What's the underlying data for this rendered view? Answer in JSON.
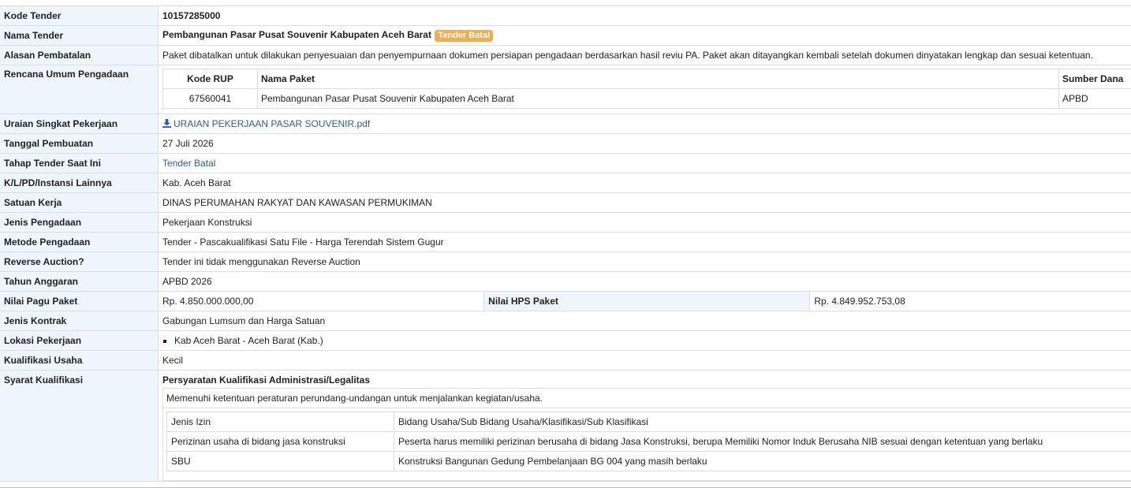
{
  "rows": {
    "kode_tender": {
      "label": "Kode Tender",
      "value": "10157285000"
    },
    "nama_tender": {
      "label": "Nama Tender",
      "value": "Pembangunan Pasar Pusat Souvenir Kabupaten Aceh Barat",
      "badge": "Tender Batal"
    },
    "alasan": {
      "label": "Alasan Pembatalan",
      "value": "Paket dibatalkan untuk dilakukan penyesuaian dan penyempurnaan dokumen persiapan pengadaan berdasarkan hasil reviu PA. Paket akan ditayangkan kembali setelah dokumen dinyatakan lengkap dan sesuai ketentuan."
    },
    "rup": {
      "label": "Rencana Umum Pengadaan",
      "headers": {
        "kode": "Kode RUP",
        "nama": "Nama Paket",
        "sumber": "Sumber Dana"
      },
      "rows": [
        {
          "kode": "67560041",
          "nama": "Pembangunan Pasar Pusat Souvenir Kabupaten Aceh Barat",
          "sumber": "APBD"
        }
      ]
    },
    "uraian": {
      "label": "Uraian Singkat Pekerjaan",
      "link": "URAIAN PEKERJAAN PASAR SOUVENIR.pdf",
      "icon": "download-icon"
    },
    "tanggal": {
      "label": "Tanggal Pembuatan",
      "value": "27 Juli 2026"
    },
    "tahap": {
      "label": "Tahap Tender Saat Ini",
      "link": "Tender Batal"
    },
    "klpd": {
      "label": "K/L/PD/Instansi Lainnya",
      "value": "Kab. Aceh Barat"
    },
    "satker": {
      "label": "Satuan Kerja",
      "value": "DINAS PERUMAHAN RAKYAT DAN KAWASAN PERMUKIMAN"
    },
    "jenis": {
      "label": "Jenis Pengadaan",
      "value": "Pekerjaan Konstruksi"
    },
    "metode": {
      "label": "Metode Pengadaan",
      "value": "Tender - Pascakualifikasi Satu File - Harga Terendah Sistem Gugur"
    },
    "reverse": {
      "label": "Reverse Auction?",
      "value": "Tender ini tidak menggunakan Reverse Auction"
    },
    "tahun": {
      "label": "Tahun Anggaran",
      "value": "APBD 2026"
    },
    "pagu": {
      "label": "Nilai Pagu Paket",
      "value": "Rp. 4.850.000.000,00",
      "hps_label": "Nilai HPS Paket",
      "hps_value": "Rp. 4.849.952.753,08"
    },
    "kontrak": {
      "label": "Jenis Kontrak",
      "value": "Gabungan Lumsum dan Harga Satuan"
    },
    "lokasi": {
      "label": "Lokasi Pekerjaan",
      "items": [
        "Kab Aceh Barat - Aceh Barat (Kab.)"
      ]
    },
    "kualifikasi": {
      "label": "Kualifikasi Usaha",
      "value": "Kecil"
    },
    "syarat": {
      "label": "Syarat Kualifikasi",
      "title": "Persyaratan Kualifikasi Administrasi/Legalitas",
      "desc": "Memenuhi ketentuan peraturan perundang-undangan untuk menjalankan kegiatan/usaha.",
      "table": [
        {
          "a": "Jenis Izin",
          "b": "Bidang Usaha/Sub Bidang Usaha/Klasifikasi/Sub Klasifikasi"
        },
        {
          "a": "Perizinan usaha di bidang jasa konstruksi",
          "b": "Peserta harus memiliki perizinan berusaha di bidang Jasa Konstruksi, berupa Memiliki Nomor Induk Berusaha NIB sesuai dengan ketentuan yang berlaku"
        },
        {
          "a": "SBU",
          "b": "Konstruksi Bangunan Gedung Pembelanjaan BG 004 yang masih berlaku"
        }
      ]
    }
  },
  "colors": {
    "header_bg": "#eef5fb",
    "badge": "#f0ad4e",
    "link": "#2a5ca8"
  }
}
